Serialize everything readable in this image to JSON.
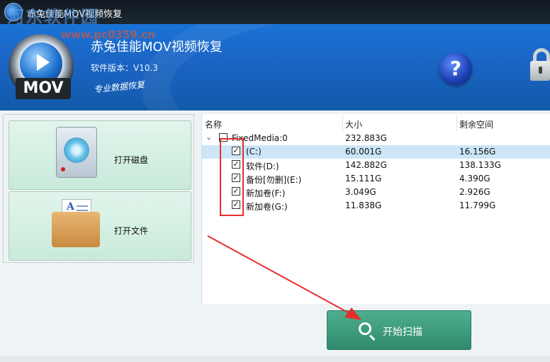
{
  "window": {
    "title": "赤兔佳能MOV视频恢复",
    "small_icon_label": "MOV"
  },
  "watermark": {
    "text": "河东软件园",
    "url": "www.pc0359.cn"
  },
  "header": {
    "logo_text": "MOV",
    "app_title": "赤兔佳能MOV视频恢复",
    "version": "软件版本：V10.3",
    "slogan": "专业数据恢复",
    "help_label": "?",
    "lock_icon": "lock-icon"
  },
  "left": {
    "open_disk": "打开磁盘",
    "open_file": "打开文件",
    "doc_letter": "A"
  },
  "table": {
    "headers": [
      "名称",
      "大小",
      "剩余空间"
    ],
    "root": {
      "name": "FixedMedia:0",
      "size": "232.883G",
      "free": "",
      "checked": false
    },
    "rows": [
      {
        "name": "(C:)",
        "size": "60.001G",
        "free": "16.156G",
        "checked": true,
        "selected": true
      },
      {
        "name": "软件(D:)",
        "size": "142.882G",
        "free": "138.133G",
        "checked": true,
        "selected": false
      },
      {
        "name": "备份[勿删](E:)",
        "size": "15.111G",
        "free": "4.390G",
        "checked": true,
        "selected": false
      },
      {
        "name": "新加卷(F:)",
        "size": "3.049G",
        "free": "2.926G",
        "checked": true,
        "selected": false
      },
      {
        "name": "新加卷(G:)",
        "size": "11.838G",
        "free": "11.799G",
        "checked": true,
        "selected": false
      }
    ]
  },
  "scan_button": {
    "label": "开始扫描",
    "icon": "search-icon"
  },
  "colors": {
    "header_blue": "#1b64c4",
    "scan_green": "#3d9c7d",
    "annotation_red": "#e62d2d"
  }
}
